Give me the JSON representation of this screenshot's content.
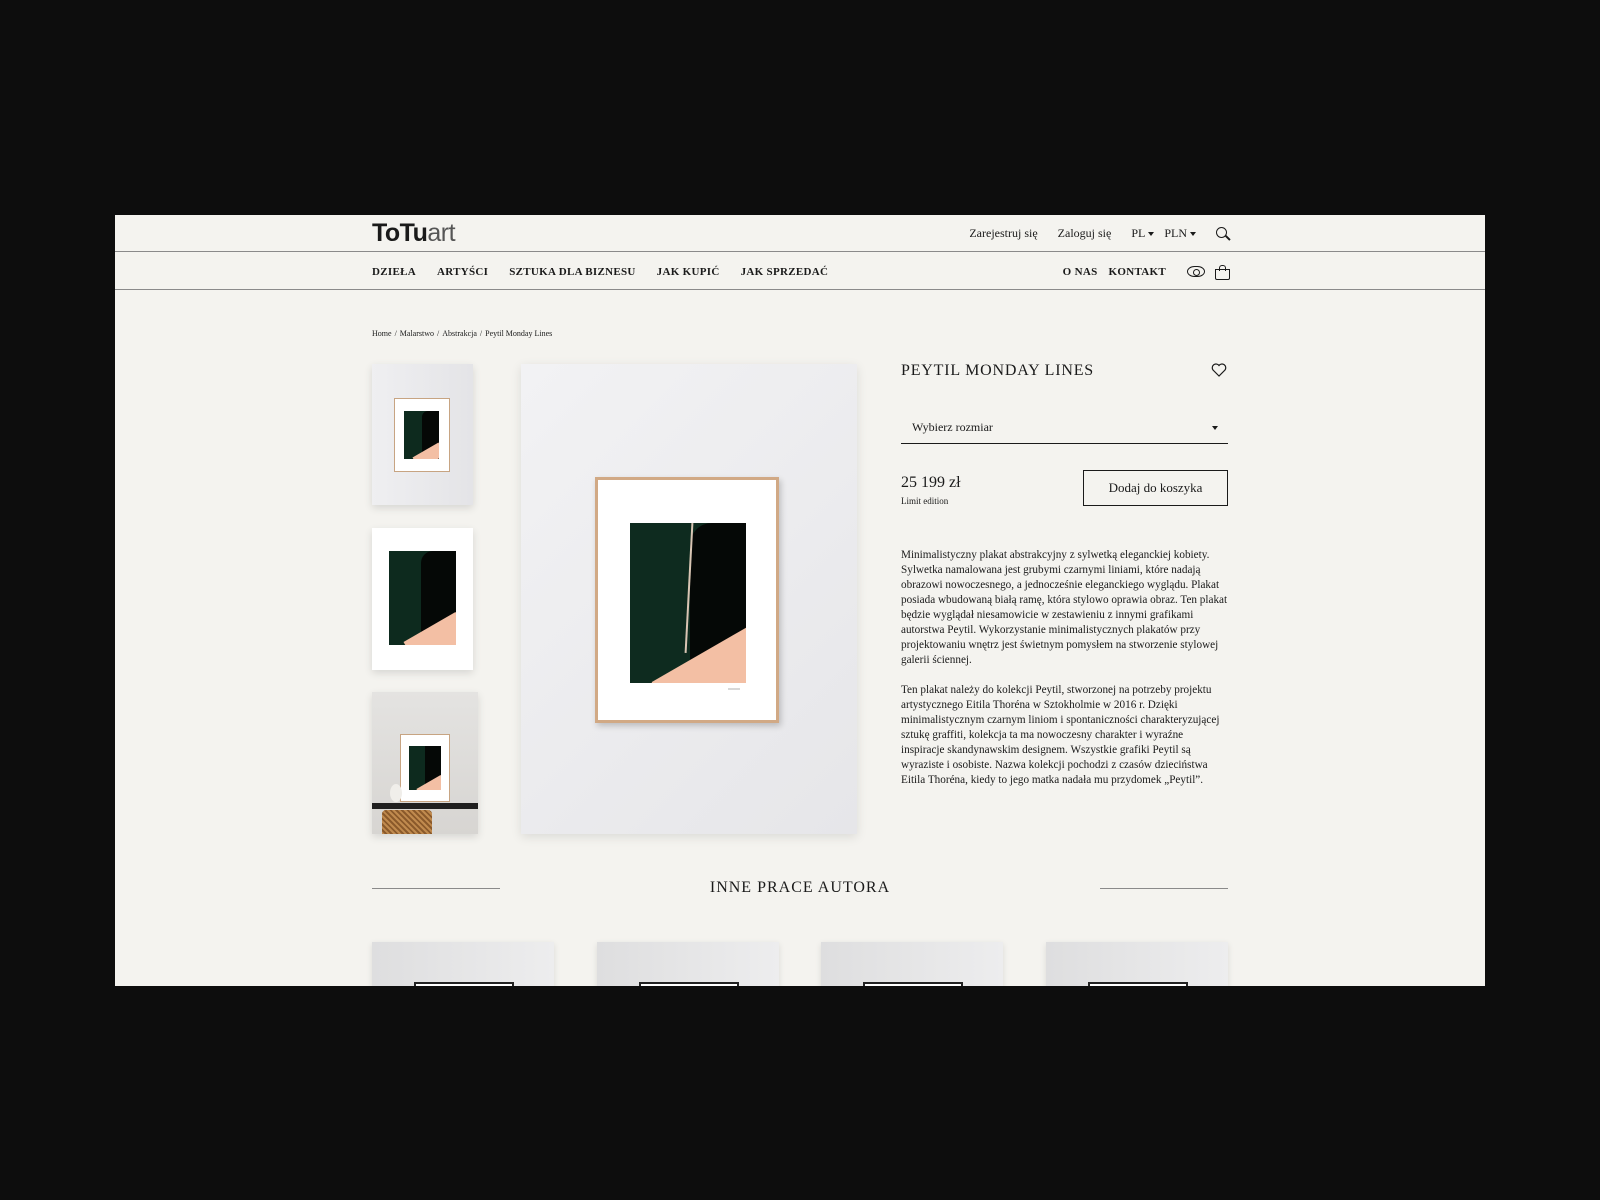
{
  "header": {
    "logo_bold": "ToTu",
    "logo_light": "art",
    "register": "Zarejestruj się",
    "login": "Zaloguj się",
    "language": "PL",
    "currency": "PLN"
  },
  "nav": {
    "left": [
      "DZIEŁA",
      "ARTYŚCI",
      "SZTUKA DLA BIZNESU",
      "JAK KUPIĆ",
      "JAK SPRZEDAĆ"
    ],
    "right": [
      "O NAS",
      "KONTAKT"
    ]
  },
  "breadcrumb": [
    "Home",
    "/",
    "Malarstwo",
    "/",
    "Abstrakcja",
    "/",
    "Peytil Monday Lines"
  ],
  "product": {
    "title": "PEYTIL MONDAY LINES",
    "size_placeholder": "Wybierz rozmiar",
    "price": "25 199 zł",
    "edition": "Limit edition",
    "add_to_cart": "Dodaj do koszyka",
    "description": [
      "Minimalistyczny plakat abstrakcyjny z sylwetką eleganckiej kobiety. Sylwetka namalowana jest grubymi czarnymi liniami, które nadają obrazowi nowoczesnego, a jednocześnie eleganckiego wyglądu. Plakat posiada wbudowaną białą ramę, która stylowo oprawia obraz. Ten plakat będzie wyglądał niesamowicie w zestawieniu z innymi grafikami autorstwa Peytil. Wykorzystanie minimalistycznych plakatów przy projektowaniu wnętrz jest świetnym pomysłem na stworzenie stylowej galerii ściennej.",
      "Ten plakat należy do kolekcji Peytil, stworzonej na potrzeby projektu artystycznego Eitila Thoréna w Sztokholmie w 2016 r. Dzięki minimalistycznym czarnym liniom i spontaniczności charakteryzującej sztukę graffiti, kolekcja ta ma nowoczesny charakter i wyraźne inspiracje skandynawskim designem. Wszystkie grafiki Peytil są wyraziste i osobiste. Nazwa kolekcji pochodzi z czasów dzieciństwa Eitila Thoréna, kiedy to jego matka nadała mu przydomek „Peytil”."
    ]
  },
  "section": {
    "title": "INNE PRACE AUTORA"
  },
  "colors": {
    "page_bg": "#f4f3ef",
    "outer_bg": "#0d0d0d",
    "art_green": "#0e2b1f",
    "art_peach": "#f3bfa4",
    "frame_wood": "#d1a985"
  },
  "icons": [
    "search-icon",
    "eye-icon",
    "basket-icon",
    "heart-icon",
    "chevron-down-icon"
  ]
}
